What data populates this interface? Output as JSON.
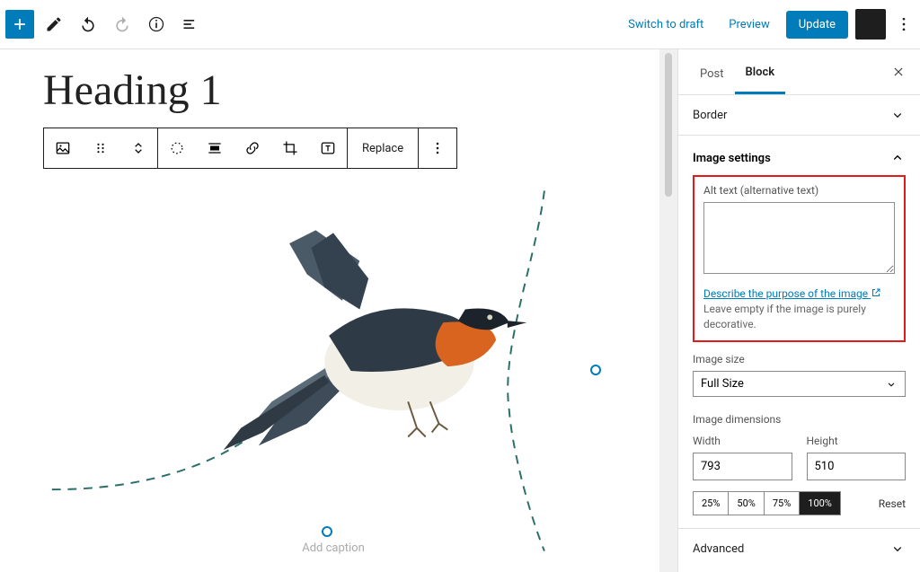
{
  "topbar": {
    "switch_to_draft": "Switch to draft",
    "preview": "Preview",
    "update": "Update"
  },
  "editor": {
    "heading": "Heading 1",
    "replace_label": "Replace",
    "caption_placeholder": "Add caption"
  },
  "sidebar": {
    "tabs": {
      "post": "Post",
      "block": "Block"
    },
    "panels": {
      "border": "Border",
      "image_settings": "Image settings",
      "advanced": "Advanced"
    },
    "alt": {
      "label": "Alt text (alternative text)",
      "value": "",
      "describe_link": "Describe the purpose of the image",
      "help_tail": " Leave empty if the image is purely decorative."
    },
    "image_size": {
      "label": "Image size",
      "selected": "Full Size"
    },
    "dimensions": {
      "label": "Image dimensions",
      "width_label": "Width",
      "height_label": "Height",
      "width": "793",
      "height": "510",
      "pct": [
        "25%",
        "50%",
        "75%",
        "100%"
      ],
      "reset": "Reset"
    }
  }
}
